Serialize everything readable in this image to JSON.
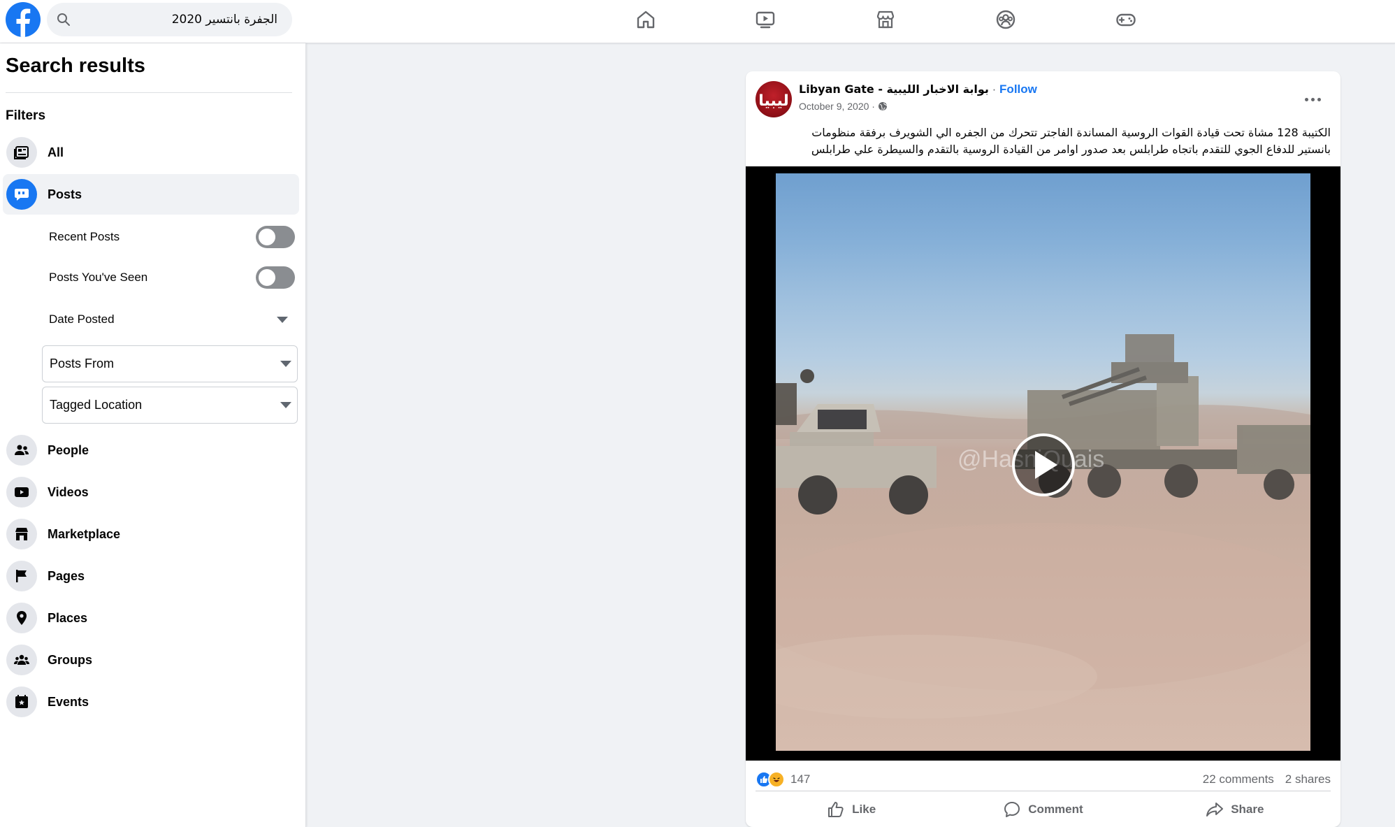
{
  "topbar": {
    "logo_icon": "facebook-logo",
    "search": {
      "icon": "search-icon",
      "value": "الجفرة بانتسير 2020"
    },
    "nav_tabs": [
      {
        "name": "home",
        "icon": "home-icon"
      },
      {
        "name": "watch",
        "icon": "video-icon"
      },
      {
        "name": "marketplace",
        "icon": "marketplace-icon"
      },
      {
        "name": "groups",
        "icon": "groups-icon"
      },
      {
        "name": "gaming",
        "icon": "gaming-icon"
      }
    ]
  },
  "sidebar": {
    "title": "Search results",
    "filters_label": "Filters",
    "items": [
      {
        "label": "All",
        "icon": "all-results-icon",
        "active": false
      },
      {
        "label": "Posts",
        "icon": "posts-icon",
        "active": true
      },
      {
        "label": "People",
        "icon": "people-icon",
        "active": false
      },
      {
        "label": "Videos",
        "icon": "videos-icon",
        "active": false
      },
      {
        "label": "Marketplace",
        "icon": "marketplace-icon",
        "active": false
      },
      {
        "label": "Pages",
        "icon": "flag-icon",
        "active": false
      },
      {
        "label": "Places",
        "icon": "pin-icon",
        "active": false
      },
      {
        "label": "Groups",
        "icon": "groups-icon",
        "active": false
      },
      {
        "label": "Events",
        "icon": "calendar-star-icon",
        "active": false
      }
    ],
    "post_filters": {
      "recent_posts": {
        "label": "Recent Posts",
        "on": false
      },
      "posts_seen": {
        "label": "Posts You've Seen",
        "on": false
      },
      "date_posted": {
        "label": "Date Posted"
      },
      "posts_from": {
        "label": "Posts From"
      },
      "tagged_location": {
        "label": "Tagged Location"
      }
    }
  },
  "post": {
    "author": "Libyan Gate - بوابة الاخبار الليبية",
    "separator": "·",
    "follow_label": "Follow",
    "date": "October 9, 2020 ·",
    "privacy_icon": "globe-icon",
    "avatar_text": "ليبيا",
    "text_line1": "الكتيبة 128 مشاة تحت قيادة القوات الروسية  المساندة الفاجتر تتحرك من الجفره الي الشويرف برفقة منظومات",
    "text_line2": "بانستير للدفاع الجوي للتقدم باتجاه طرابلس بعد صدور اوامر من القيادة الروسية بالتقدم والسيطرة علي طرابلس",
    "video": {
      "watermark": "@HasniQuais",
      "play_icon": "play-icon"
    },
    "reactions": {
      "icons": [
        "like-reaction-icon",
        "haha-reaction-icon"
      ],
      "count": "147"
    },
    "comments": "22 comments",
    "shares": "2 shares",
    "actions": {
      "like": "Like",
      "comment": "Comment",
      "share": "Share"
    }
  },
  "colors": {
    "brand": "#1877f2",
    "page_bg": "#f0f2f5",
    "secondary_text": "#65676b"
  }
}
